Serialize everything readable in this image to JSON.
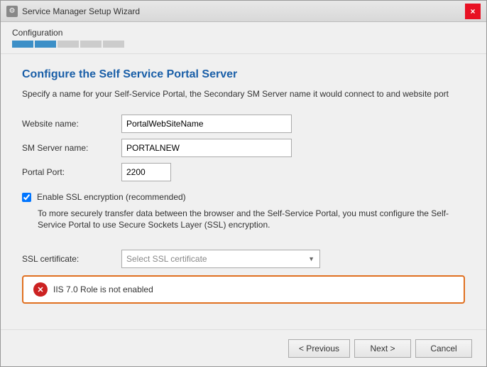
{
  "window": {
    "title": "Service Manager Setup Wizard",
    "close_icon": "×"
  },
  "progress": {
    "label": "Configuration",
    "segments": [
      true,
      true,
      false,
      false,
      false
    ]
  },
  "section": {
    "title": "Configure the Self Service Portal Server",
    "description": "Specify a name for your Self-Service Portal, the Secondary SM Server name it would connect to and website port"
  },
  "form": {
    "website_label": "Website name:",
    "website_value": "PortalWebSiteName",
    "sm_server_label": "SM Server name:",
    "sm_server_value": "PORTALNEW",
    "portal_port_label": "Portal Port:",
    "portal_port_value": "2200"
  },
  "ssl": {
    "enable_label": "Enable SSL encryption (recommended)",
    "enable_desc": "To more securely transfer data between the browser and the Self-Service Portal, you must configure the Self-Service Portal to use Secure Sockets Layer (SSL) encryption.",
    "cert_label": "SSL certificate:",
    "cert_placeholder": "Select SSL certificate",
    "checked": true
  },
  "error": {
    "text": "IIS 7.0 Role is not enabled"
  },
  "footer": {
    "previous_label": "< Previous",
    "next_label": "Next >",
    "cancel_label": "Cancel"
  }
}
